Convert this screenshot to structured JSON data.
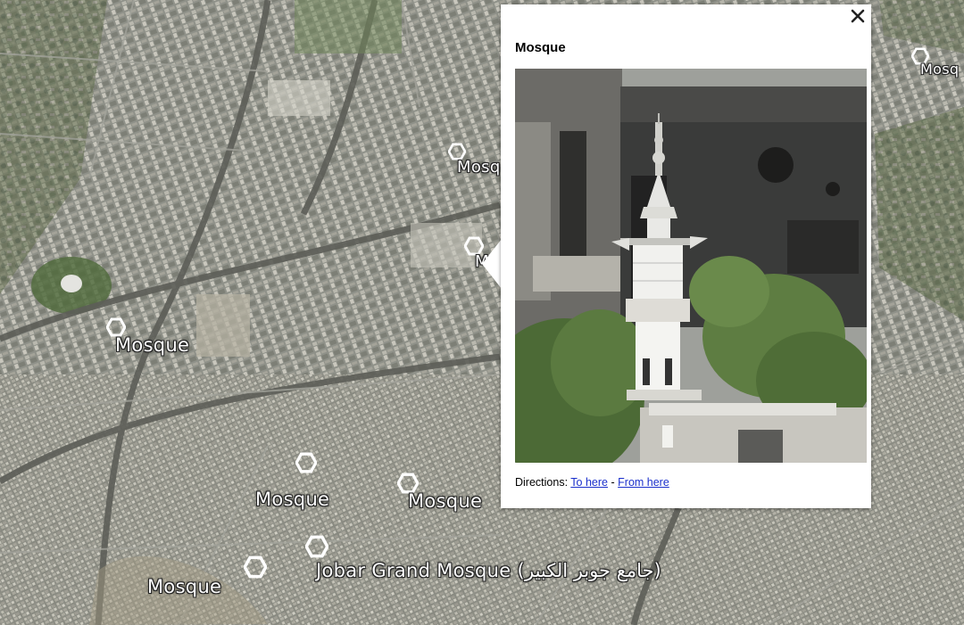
{
  "map": {
    "placemarks": [
      {
        "label": "Mosque",
        "icon": "hexagon-pin-icon"
      },
      {
        "label": "Mosque",
        "icon": "hexagon-pin-icon"
      },
      {
        "label": "M",
        "icon": "hexagon-pin-icon"
      },
      {
        "label": "Mosque",
        "icon": "hexagon-pin-icon"
      },
      {
        "label": "Mosque",
        "icon": "hexagon-pin-icon"
      },
      {
        "label": "Mosque",
        "icon": "hexagon-pin-icon"
      },
      {
        "label": "Jobar Grand Mosque (جامع جوبر الكبير)",
        "icon": "hexagon-pin-icon"
      },
      {
        "label": "Mosque",
        "icon": "hexagon-pin-icon"
      },
      {
        "label": "Mosq",
        "icon": "hexagon-pin-icon"
      }
    ]
  },
  "balloon": {
    "title": "Mosque",
    "image_alt": "Minaret of a damaged mosque",
    "directions_label": "Directions:",
    "to_here": "To here",
    "separator": "-",
    "from_here": "From here",
    "close_icon": "close-icon"
  },
  "colors": {
    "label_text": "#ffffff",
    "link": "#1a2fcc",
    "balloon_bg": "#ffffff"
  }
}
